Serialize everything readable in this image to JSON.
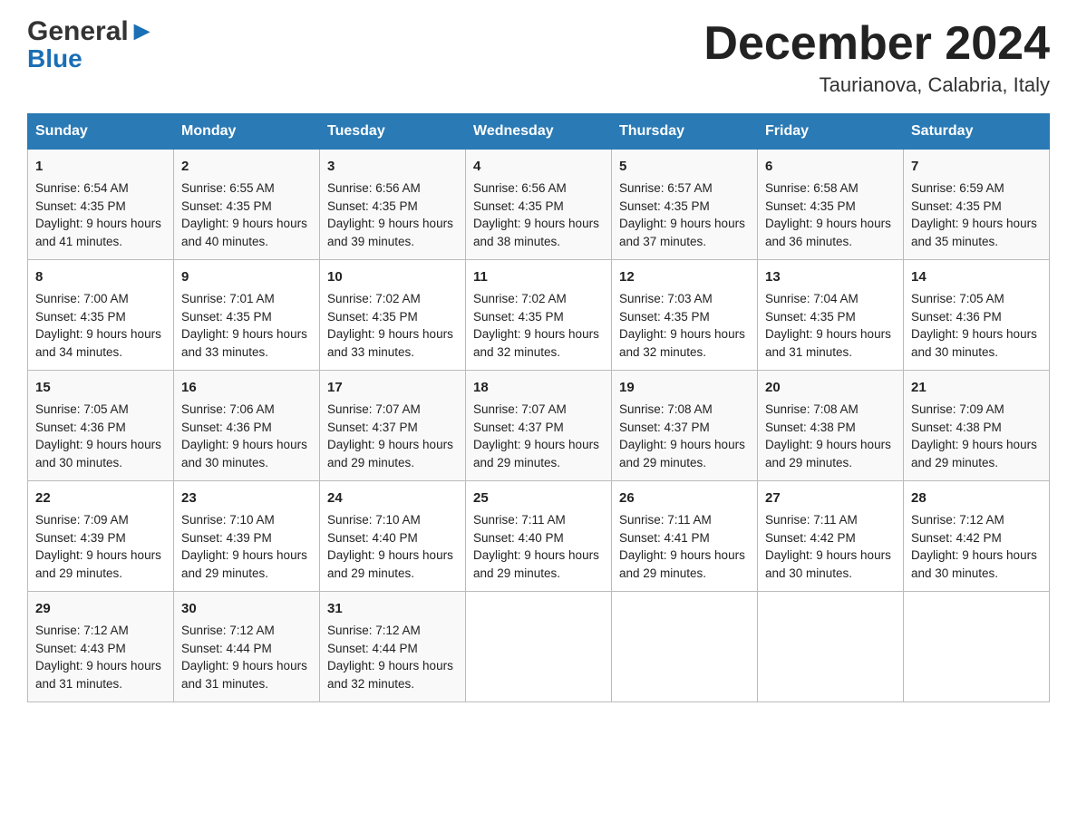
{
  "header": {
    "month_title": "December 2024",
    "location": "Taurianova, Calabria, Italy",
    "logo_general": "General",
    "logo_blue": "Blue"
  },
  "days_of_week": [
    "Sunday",
    "Monday",
    "Tuesday",
    "Wednesday",
    "Thursday",
    "Friday",
    "Saturday"
  ],
  "weeks": [
    [
      {
        "day": "1",
        "sunrise": "6:54 AM",
        "sunset": "4:35 PM",
        "daylight": "9 hours and 41 minutes."
      },
      {
        "day": "2",
        "sunrise": "6:55 AM",
        "sunset": "4:35 PM",
        "daylight": "9 hours and 40 minutes."
      },
      {
        "day": "3",
        "sunrise": "6:56 AM",
        "sunset": "4:35 PM",
        "daylight": "9 hours and 39 minutes."
      },
      {
        "day": "4",
        "sunrise": "6:56 AM",
        "sunset": "4:35 PM",
        "daylight": "9 hours and 38 minutes."
      },
      {
        "day": "5",
        "sunrise": "6:57 AM",
        "sunset": "4:35 PM",
        "daylight": "9 hours and 37 minutes."
      },
      {
        "day": "6",
        "sunrise": "6:58 AM",
        "sunset": "4:35 PM",
        "daylight": "9 hours and 36 minutes."
      },
      {
        "day": "7",
        "sunrise": "6:59 AM",
        "sunset": "4:35 PM",
        "daylight": "9 hours and 35 minutes."
      }
    ],
    [
      {
        "day": "8",
        "sunrise": "7:00 AM",
        "sunset": "4:35 PM",
        "daylight": "9 hours and 34 minutes."
      },
      {
        "day": "9",
        "sunrise": "7:01 AM",
        "sunset": "4:35 PM",
        "daylight": "9 hours and 33 minutes."
      },
      {
        "day": "10",
        "sunrise": "7:02 AM",
        "sunset": "4:35 PM",
        "daylight": "9 hours and 33 minutes."
      },
      {
        "day": "11",
        "sunrise": "7:02 AM",
        "sunset": "4:35 PM",
        "daylight": "9 hours and 32 minutes."
      },
      {
        "day": "12",
        "sunrise": "7:03 AM",
        "sunset": "4:35 PM",
        "daylight": "9 hours and 32 minutes."
      },
      {
        "day": "13",
        "sunrise": "7:04 AM",
        "sunset": "4:35 PM",
        "daylight": "9 hours and 31 minutes."
      },
      {
        "day": "14",
        "sunrise": "7:05 AM",
        "sunset": "4:36 PM",
        "daylight": "9 hours and 30 minutes."
      }
    ],
    [
      {
        "day": "15",
        "sunrise": "7:05 AM",
        "sunset": "4:36 PM",
        "daylight": "9 hours and 30 minutes."
      },
      {
        "day": "16",
        "sunrise": "7:06 AM",
        "sunset": "4:36 PM",
        "daylight": "9 hours and 30 minutes."
      },
      {
        "day": "17",
        "sunrise": "7:07 AM",
        "sunset": "4:37 PM",
        "daylight": "9 hours and 29 minutes."
      },
      {
        "day": "18",
        "sunrise": "7:07 AM",
        "sunset": "4:37 PM",
        "daylight": "9 hours and 29 minutes."
      },
      {
        "day": "19",
        "sunrise": "7:08 AM",
        "sunset": "4:37 PM",
        "daylight": "9 hours and 29 minutes."
      },
      {
        "day": "20",
        "sunrise": "7:08 AM",
        "sunset": "4:38 PM",
        "daylight": "9 hours and 29 minutes."
      },
      {
        "day": "21",
        "sunrise": "7:09 AM",
        "sunset": "4:38 PM",
        "daylight": "9 hours and 29 minutes."
      }
    ],
    [
      {
        "day": "22",
        "sunrise": "7:09 AM",
        "sunset": "4:39 PM",
        "daylight": "9 hours and 29 minutes."
      },
      {
        "day": "23",
        "sunrise": "7:10 AM",
        "sunset": "4:39 PM",
        "daylight": "9 hours and 29 minutes."
      },
      {
        "day": "24",
        "sunrise": "7:10 AM",
        "sunset": "4:40 PM",
        "daylight": "9 hours and 29 minutes."
      },
      {
        "day": "25",
        "sunrise": "7:11 AM",
        "sunset": "4:40 PM",
        "daylight": "9 hours and 29 minutes."
      },
      {
        "day": "26",
        "sunrise": "7:11 AM",
        "sunset": "4:41 PM",
        "daylight": "9 hours and 29 minutes."
      },
      {
        "day": "27",
        "sunrise": "7:11 AM",
        "sunset": "4:42 PM",
        "daylight": "9 hours and 30 minutes."
      },
      {
        "day": "28",
        "sunrise": "7:12 AM",
        "sunset": "4:42 PM",
        "daylight": "9 hours and 30 minutes."
      }
    ],
    [
      {
        "day": "29",
        "sunrise": "7:12 AM",
        "sunset": "4:43 PM",
        "daylight": "9 hours and 31 minutes."
      },
      {
        "day": "30",
        "sunrise": "7:12 AM",
        "sunset": "4:44 PM",
        "daylight": "9 hours and 31 minutes."
      },
      {
        "day": "31",
        "sunrise": "7:12 AM",
        "sunset": "4:44 PM",
        "daylight": "9 hours and 32 minutes."
      },
      null,
      null,
      null,
      null
    ]
  ],
  "labels": {
    "sunrise": "Sunrise:",
    "sunset": "Sunset:",
    "daylight": "Daylight:"
  }
}
